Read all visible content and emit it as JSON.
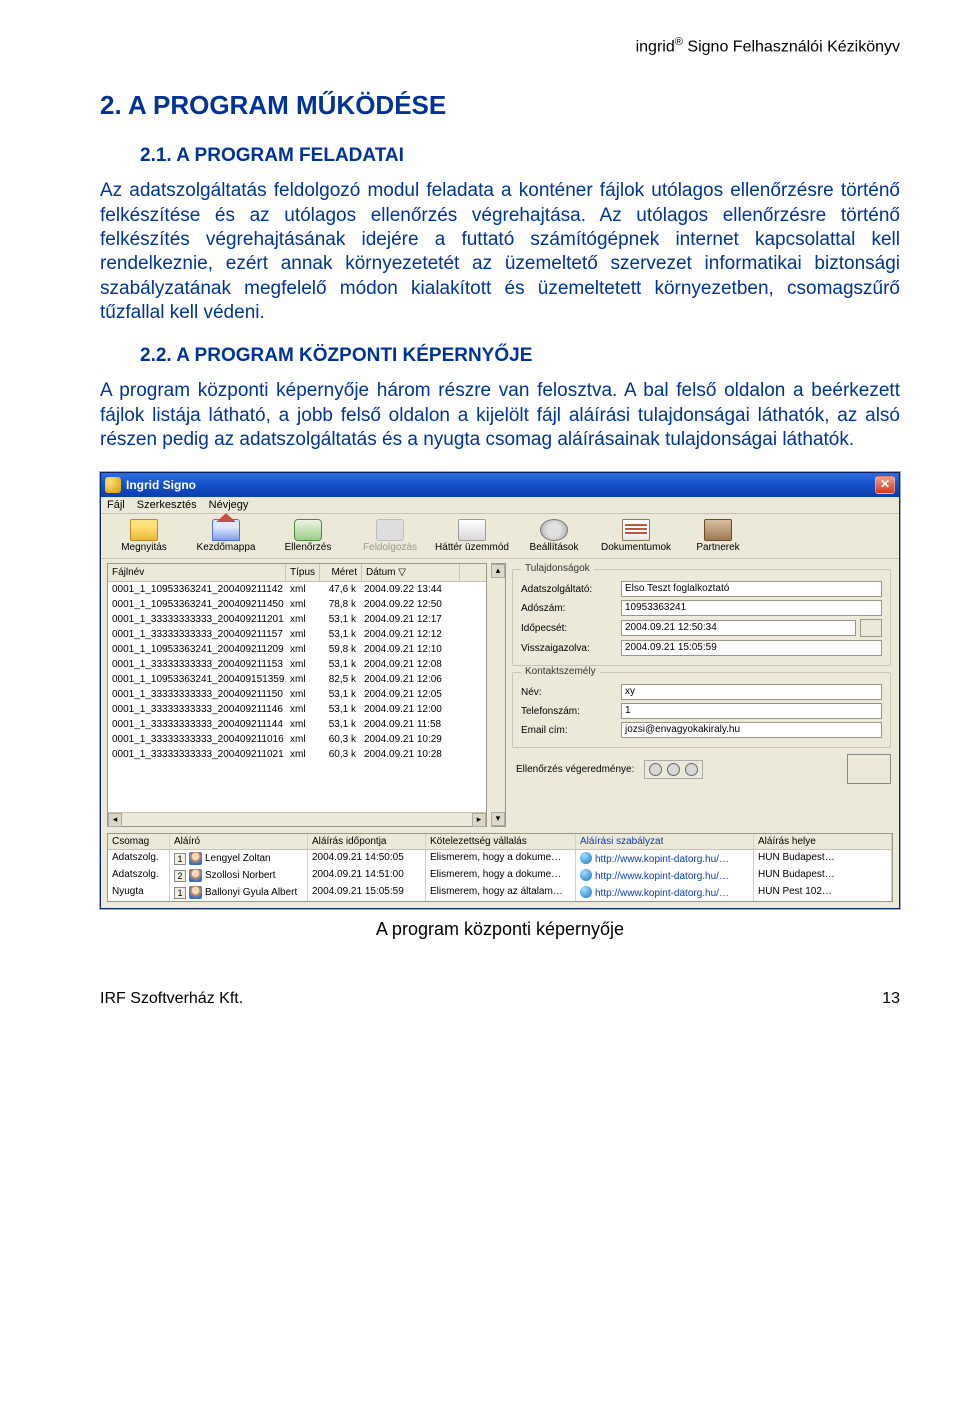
{
  "header": {
    "running": "ingrid® Signo Felhasználói Kézikönyv"
  },
  "section": {
    "h2": "2. A PROGRAM MŰKÖDÉSE",
    "h3_1": "2.1. A PROGRAM FELADATAI",
    "p1": "Az adatszolgáltatás feldolgozó modul feladata a konténer fájlok utólagos ellenőrzésre történő felkészítése és az utólagos ellenőrzés végrehajtása. Az utólagos ellenőrzésre történő felkészítés végrehajtásának idejére a futtató számítógépnek internet kapcsolattal kell rendelkeznie, ezért annak környezetetét az üzemeltető szervezet informatikai biztonsági szabályzatának megfelelő módon kialakított és üzemeltetett környezetben, csomagszűrő tűzfallal kell védeni.",
    "h3_2": "2.2. A PROGRAM KÖZPONTI KÉPERNYŐJE",
    "p2": "A program központi képernyője három részre van felosztva. A bal felső oldalon a beérkezett fájlok listája látható, a jobb felső oldalon a kijelölt fájl aláírási tulajdonságai láthatók, az alsó részen pedig az adatszolgáltatás és a nyugta csomag aláírásainak tulajdonságai láthatók."
  },
  "app": {
    "title": "Ingrid Signo",
    "menu": [
      "Fájl",
      "Szerkesztés",
      "Névjegy"
    ],
    "toolbar": [
      {
        "label": "Megnyitás",
        "ico": "ico-folder",
        "disabled": false
      },
      {
        "label": "Kezdőmappa",
        "ico": "ico-home",
        "disabled": false
      },
      {
        "label": "Ellenőrzés",
        "ico": "ico-check",
        "disabled": false
      },
      {
        "label": "Feldolgozás",
        "ico": "ico-proc",
        "disabled": true
      },
      {
        "label": "Háttér üzemmód",
        "ico": "ico-bg",
        "disabled": false
      },
      {
        "label": "Beállítások",
        "ico": "ico-gear",
        "disabled": false
      },
      {
        "label": "Dokumentumok",
        "ico": "ico-docs",
        "disabled": false
      },
      {
        "label": "Partnerek",
        "ico": "ico-partner",
        "disabled": false
      }
    ],
    "file_cols": {
      "name": "Fájlnév",
      "type": "Típus",
      "size": "Méret",
      "date": "Dátum  ▽"
    },
    "files": [
      {
        "name": "0001_1_10953363241_200409211142",
        "type": "xml",
        "size": "47,6 k",
        "date": "2004.09.22 13:44"
      },
      {
        "name": "0001_1_10953363241_200409211450",
        "type": "xml",
        "size": "78,8 k",
        "date": "2004.09.22 12:50"
      },
      {
        "name": "0001_1_33333333333_200409211201",
        "type": "xml",
        "size": "53,1 k",
        "date": "2004.09.21 12:17"
      },
      {
        "name": "0001_1_33333333333_200409211157",
        "type": "xml",
        "size": "53,1 k",
        "date": "2004.09.21 12:12"
      },
      {
        "name": "0001_1_10953363241_200409211209",
        "type": "xml",
        "size": "59,8 k",
        "date": "2004.09.21 12:10"
      },
      {
        "name": "0001_1_33333333333_200409211153",
        "type": "xml",
        "size": "53,1 k",
        "date": "2004.09.21 12:08"
      },
      {
        "name": "0001_1_10953363241_200409151359…",
        "type": "xml",
        "size": "82,5 k",
        "date": "2004.09.21 12:06"
      },
      {
        "name": "0001_1_33333333333_200409211150",
        "type": "xml",
        "size": "53,1 k",
        "date": "2004.09.21 12:05"
      },
      {
        "name": "0001_1_33333333333_200409211146",
        "type": "xml",
        "size": "53,1 k",
        "date": "2004.09.21 12:00"
      },
      {
        "name": "0001_1_33333333333_200409211144",
        "type": "xml",
        "size": "53,1 k",
        "date": "2004.09.21 11:58"
      },
      {
        "name": "0001_1_33333333333_200409211016",
        "type": "xml",
        "size": "60,3 k",
        "date": "2004.09.21 10:29"
      },
      {
        "name": "0001_1_33333333333_200409211021",
        "type": "xml",
        "size": "60,3 k",
        "date": "2004.09.21 10:28"
      }
    ],
    "props": {
      "group": "Tulajdonságok",
      "labels": {
        "provider": "Adatszolgáltató:",
        "tax": "Adószám:",
        "ts": "Időpecsét:",
        "ack": "Visszaigazolva:"
      },
      "values": {
        "provider": "Elso Teszt foglalkoztató",
        "tax": "10953363241",
        "ts": "2004.09.21 12:50:34",
        "ack": "2004.09.21 15:05:59"
      }
    },
    "contact": {
      "group": "Kontaktszemély",
      "labels": {
        "name": "Név:",
        "phone": "Telefonszám:",
        "email": "Email cím:"
      },
      "values": {
        "name": "xy",
        "phone": "1",
        "email": "jozsi@envagyokakiraly.hu"
      }
    },
    "verify_label": "Ellenőrzés végeredménye:",
    "sig_cols": {
      "pkg": "Csomag",
      "signer": "Aláíró",
      "time": "Aláírás időpontja",
      "comm": "Kötelezettség vállalás",
      "pol": "Aláírási szabályzat",
      "loc": "Aláírás helye"
    },
    "sigs": [
      {
        "pkg": "Adatszolg.",
        "n": "1",
        "signer": "Lengyel Zoltan",
        "time": "2004.09.21 14:50:05",
        "comm": "Elismerem, hogy a dokume…",
        "pol": "http://www.kopint-datorg.hu/…",
        "loc": "HUN Budapest…"
      },
      {
        "pkg": "Adatszolg.",
        "n": "2",
        "signer": "Szollosi Norbert",
        "time": "2004.09.21 14:51:00",
        "comm": "Elismerem, hogy a dokume…",
        "pol": "http://www.kopint-datorg.hu/…",
        "loc": "HUN Budapest…"
      },
      {
        "pkg": "Nyugta",
        "n": "1",
        "signer": "Ballonyi Gyula Albert",
        "time": "2004.09.21 15:05:59",
        "comm": "Elismerem, hogy az általam…",
        "pol": "http://www.kopint-datorg.hu/…",
        "loc": "HUN Pest 102…"
      }
    ]
  },
  "caption": "A program központi képernyője",
  "footer": {
    "left": "IRF Szoftverház Kft.",
    "right": "13"
  }
}
